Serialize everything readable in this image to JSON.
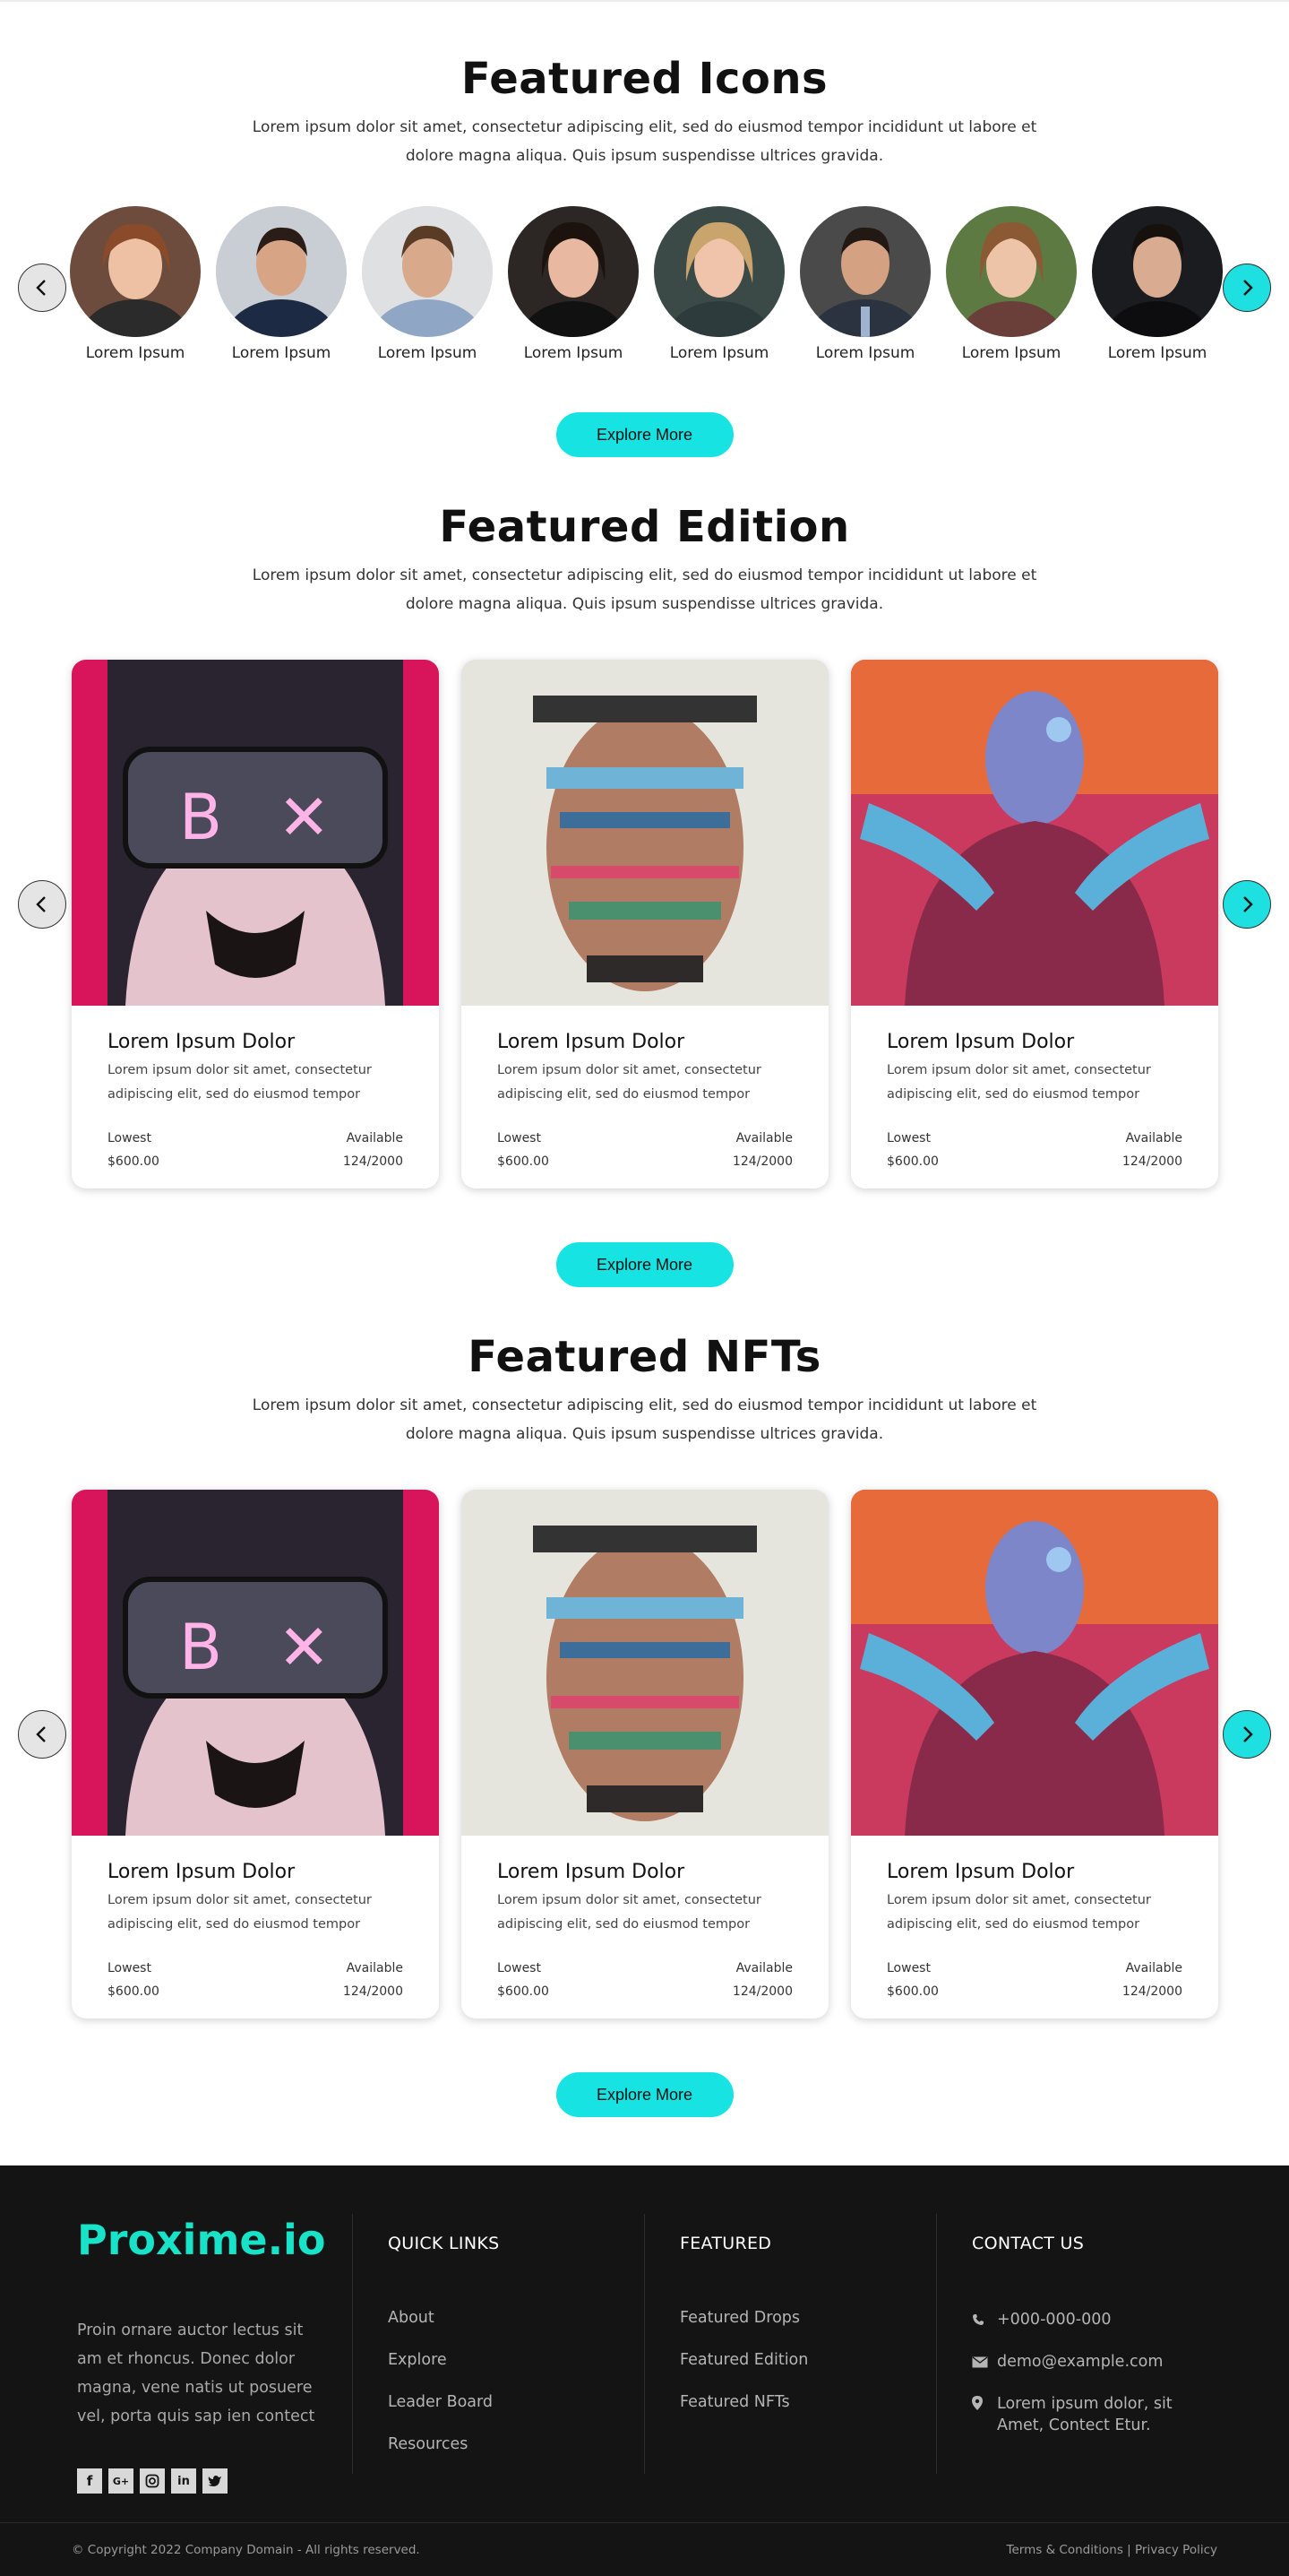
{
  "featured_icons": {
    "title": "Featured Icons",
    "description": "Lorem ipsum dolor sit amet, consectetur adipiscing elit, sed do eiusmod tempor incididunt ut labore et dolore magna aliqua. Quis ipsum suspendisse ultrices gravida.",
    "people": [
      {
        "name": "Lorem Ipsum"
      },
      {
        "name": "Lorem Ipsum"
      },
      {
        "name": "Lorem Ipsum"
      },
      {
        "name": "Lorem Ipsum"
      },
      {
        "name": "Lorem Ipsum"
      },
      {
        "name": "Lorem Ipsum"
      },
      {
        "name": "Lorem Ipsum"
      },
      {
        "name": "Lorem Ipsum"
      }
    ],
    "button": "Explore More"
  },
  "featured_edition": {
    "title": "Featured Edition",
    "description": "Lorem ipsum dolor sit amet, consectetur adipiscing elit, sed do eiusmod tempor incididunt ut labore et dolore magna aliqua. Quis ipsum suspendisse ultrices gravida.",
    "cards": [
      {
        "title": "Lorem Ipsum Dolor",
        "desc": "Lorem ipsum dolor sit amet, consectetur adipiscing elit, sed do eiusmod tempor",
        "lowest_label": "Lowest",
        "lowest": "$600.00",
        "available_label": "Available",
        "available": "124/2000"
      },
      {
        "title": "Lorem Ipsum Dolor",
        "desc": "Lorem ipsum dolor sit amet, consectetur adipiscing elit, sed do eiusmod tempor",
        "lowest_label": "Lowest",
        "lowest": "$600.00",
        "available_label": "Available",
        "available": "124/2000"
      },
      {
        "title": "Lorem Ipsum Dolor",
        "desc": "Lorem ipsum dolor sit amet, consectetur adipiscing elit, sed do eiusmod tempor",
        "lowest_label": "Lowest",
        "lowest": "$600.00",
        "available_label": "Available",
        "available": "124/2000"
      }
    ],
    "button": "Explore More"
  },
  "featured_nfts": {
    "title": "Featured NFTs",
    "description": "Lorem ipsum dolor sit amet, consectetur adipiscing elit, sed do eiusmod tempor incididunt ut labore et dolore magna aliqua. Quis ipsum suspendisse ultrices gravida.",
    "cards": [
      {
        "title": "Lorem Ipsum Dolor",
        "desc": "Lorem ipsum dolor sit amet, consectetur adipiscing elit, sed do eiusmod tempor",
        "lowest_label": "Lowest",
        "lowest": "$600.00",
        "available_label": "Available",
        "available": "124/2000"
      },
      {
        "title": "Lorem Ipsum Dolor",
        "desc": "Lorem ipsum dolor sit amet, consectetur adipiscing elit, sed do eiusmod tempor",
        "lowest_label": "Lowest",
        "lowest": "$600.00",
        "available_label": "Available",
        "available": "124/2000"
      },
      {
        "title": "Lorem Ipsum Dolor",
        "desc": "Lorem ipsum dolor sit amet, consectetur adipiscing elit, sed do eiusmod tempor",
        "lowest_label": "Lowest",
        "lowest": "$600.00",
        "available_label": "Available",
        "available": "124/2000"
      }
    ],
    "button": "Explore More"
  },
  "footer": {
    "brand": "Proxime.io",
    "about": "Proin ornare auctor lectus sit am et rhoncus. Donec dolor magna, vene natis ut posuere vel, porta quis sap ien contect",
    "social_icons": [
      "facebook-icon",
      "google-plus-icon",
      "instagram-icon",
      "linkedin-icon",
      "twitter-icon"
    ],
    "quick_links": {
      "heading": "QUICK LINKS",
      "items": [
        "About",
        "Explore",
        "Leader Board",
        "Resources"
      ]
    },
    "featured": {
      "heading": "FEATURED",
      "items": [
        "Featured Drops",
        "Featured Edition",
        "Featured NFTs"
      ]
    },
    "contact": {
      "heading": "CONTACT US",
      "phone": "+000-000-000",
      "email": "demo@example.com",
      "address": "Lorem ipsum dolor, sit Amet, Contect Etur."
    },
    "copyright": "© Copyright 2022 Company Domain - All rights reserved.",
    "legal": "Terms & Conditions | Privacy Policy"
  },
  "colors": {
    "accent": "#18e3e3",
    "brand": "#18e3c8",
    "footer_bg": "#141414"
  }
}
